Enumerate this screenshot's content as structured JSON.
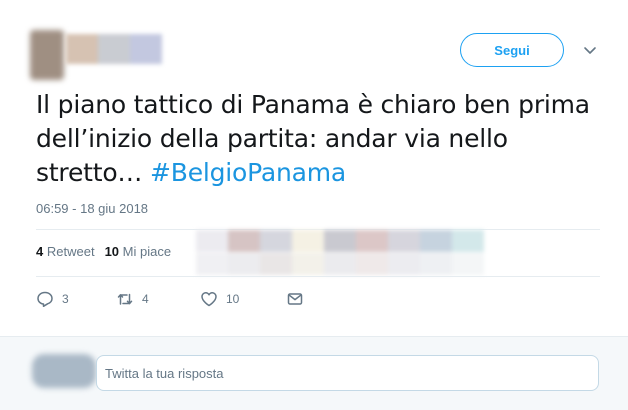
{
  "tweet": {
    "follow_label": "Segui",
    "text_plain": "Il piano tattico di Panama è chiaro ben prima dell’inizio della partita: andar via nello stretto…",
    "hashtag": "#BelgioPanama",
    "timestamp": "06:59 - 18 giu 2018",
    "stats": {
      "retweets_count": "4",
      "retweets_label": "Retweet",
      "likes_count": "10",
      "likes_label": "Mi piace"
    },
    "actions": {
      "reply_count": "3",
      "retweet_count": "4",
      "like_count": "10"
    }
  },
  "reply": {
    "placeholder": "Twitta la tua risposta"
  },
  "colors": {
    "accent": "#1da1f2",
    "hashtag": "#1b95e0",
    "muted": "#657786",
    "text": "#14171a"
  }
}
